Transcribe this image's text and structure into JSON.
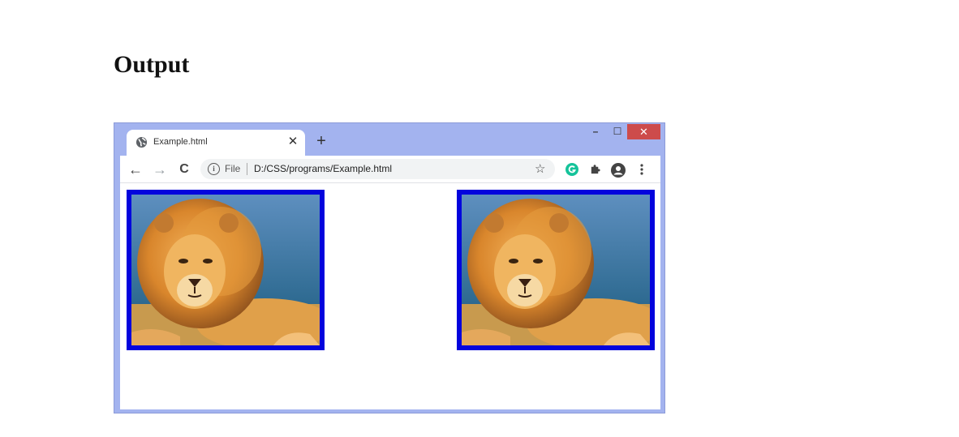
{
  "heading": "Output",
  "browser": {
    "tab": {
      "title": "Example.html",
      "close_symbol": "✕",
      "icon": "globe-icon"
    },
    "new_tab_symbol": "+",
    "window_controls": {
      "minimize": "–",
      "maximize": "☐",
      "close": "✕"
    },
    "nav": {
      "back": "←",
      "forward": "→",
      "reload": "C"
    },
    "address": {
      "info": "i",
      "scheme_label": "File",
      "url": "D:/CSS/programs/Example.html"
    },
    "extensions": [
      "grammarly-icon",
      "puzzle-icon",
      "profile-icon",
      "menu-icon"
    ],
    "colors": {
      "frame": "#a3b3ef",
      "close_button": "#cd4b4b",
      "image_border": "#0404dd"
    }
  },
  "content": {
    "images": [
      {
        "subject": "lion-image"
      },
      {
        "subject": "lion-image"
      }
    ]
  }
}
